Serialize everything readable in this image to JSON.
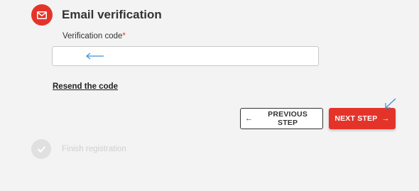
{
  "step_email": {
    "title": "Email verification",
    "icon": "envelope-icon",
    "accent_color": "#e4342a"
  },
  "verification": {
    "label": "Verification code",
    "required_marker": "*",
    "value": "",
    "placeholder": ""
  },
  "resend": {
    "label": "Resend the code"
  },
  "buttons": {
    "previous_label": "PREVIOUS STEP",
    "previous_arrow": "←",
    "next_label": "NEXT STEP",
    "next_arrow": "→"
  },
  "step_finish": {
    "title": "Finish registration",
    "icon": "check-icon",
    "state": "inactive"
  },
  "annotations": {
    "color": "#3a8fd9"
  }
}
